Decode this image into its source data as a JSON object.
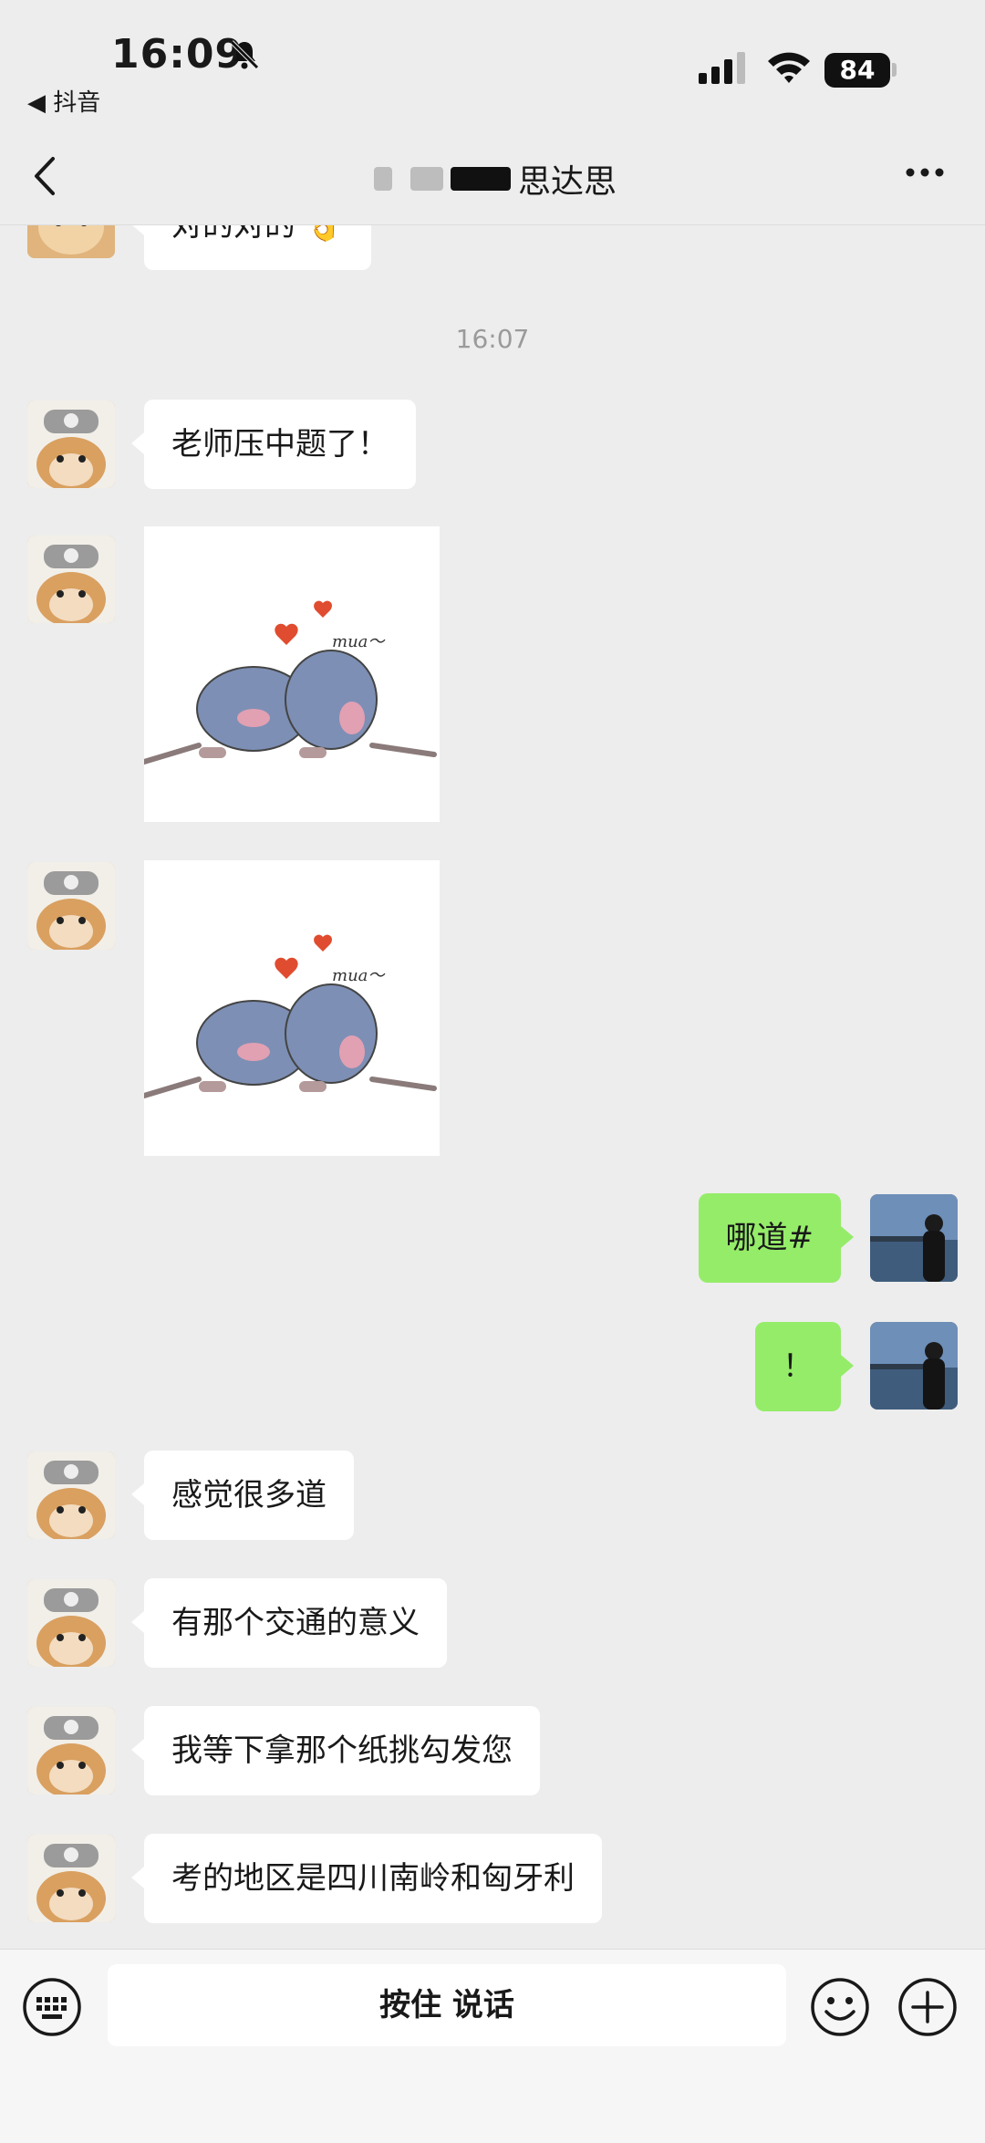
{
  "status_bar": {
    "time": "16:09",
    "back_app_label": "◀ 抖音",
    "battery_level": "84"
  },
  "nav": {
    "title": "思达思"
  },
  "messages": [
    {
      "side": "in",
      "type": "text",
      "text": "对的对的 👌"
    },
    {
      "side": "center",
      "type": "time",
      "text": "16:07"
    },
    {
      "side": "in",
      "type": "text",
      "text": "老师压中题了！"
    },
    {
      "side": "in",
      "type": "sticker",
      "caption": "mua～"
    },
    {
      "side": "in",
      "type": "sticker",
      "caption": "mua～"
    },
    {
      "side": "out",
      "type": "text",
      "text": "哪道#"
    },
    {
      "side": "out",
      "type": "text",
      "text": "！"
    },
    {
      "side": "in",
      "type": "text",
      "text": "感觉很多道"
    },
    {
      "side": "in",
      "type": "text",
      "text": "有那个交通的意义"
    },
    {
      "side": "in",
      "type": "text",
      "text": "我等下拿那个纸挑勾发您"
    },
    {
      "side": "in",
      "type": "text",
      "text": "考的地区是四川南岭和匈牙利"
    }
  ],
  "input_bar": {
    "voice_label": "按住 说话"
  },
  "icons": {
    "keyboard": "keyboard-icon",
    "emoji": "emoji-icon",
    "plus": "plus-icon"
  },
  "colors": {
    "background": "#ededed",
    "outgoing_bubble": "#95ec69",
    "incoming_bubble": "#ffffff"
  }
}
